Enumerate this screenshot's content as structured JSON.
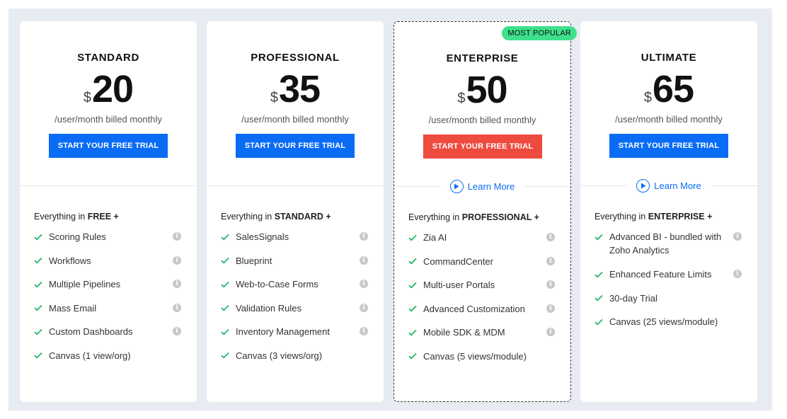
{
  "badge": "MOST POPULAR",
  "plans": [
    {
      "name": "STANDARD",
      "currency": "$",
      "price": "20",
      "billing": "/user/month billed monthly",
      "cta": "START YOUR FREE TRIAL",
      "everything_prefix": "Everything in ",
      "everything_tier": "FREE +",
      "features": [
        "Scoring Rules",
        "Workflows",
        "Multiple Pipelines",
        "Mass Email",
        "Custom Dashboards",
        "Canvas (1 view/org)"
      ]
    },
    {
      "name": "PROFESSIONAL",
      "currency": "$",
      "price": "35",
      "billing": "/user/month billed monthly",
      "cta": "START YOUR FREE TRIAL",
      "everything_prefix": "Everything in ",
      "everything_tier": "STANDARD +",
      "features": [
        "SalesSignals",
        "Blueprint",
        "Web-to-Case Forms",
        "Validation Rules",
        "Inventory Management",
        "Canvas (3 views/org)"
      ]
    },
    {
      "name": "ENTERPRISE",
      "currency": "$",
      "price": "50",
      "billing": "/user/month billed monthly",
      "cta": "START YOUR FREE TRIAL",
      "learn_more": "Learn More",
      "everything_prefix": "Everything in ",
      "everything_tier": "PROFESSIONAL +",
      "features": [
        "Zia AI",
        "CommandCenter",
        "Multi-user Portals",
        "Advanced Customization",
        "Mobile SDK & MDM",
        "Canvas (5 views/module)"
      ]
    },
    {
      "name": "ULTIMATE",
      "currency": "$",
      "price": "65",
      "billing": "/user/month billed monthly",
      "cta": "START YOUR FREE TRIAL",
      "learn_more": "Learn More",
      "everything_prefix": "Everything in ",
      "everything_tier": "ENTERPRISE +",
      "features": [
        "Advanced BI - bundled with Zoho Analytics",
        "Enhanced Feature Limits",
        "30-day Trial",
        "Canvas (25 views/module)"
      ]
    }
  ],
  "colors": {
    "primary_cta": "#0a6cf5",
    "featured_cta": "#ee4b3f",
    "badge": "#3ee08b",
    "check": "#1fb86a",
    "background": "#e7ebf2"
  },
  "icons": {
    "check": "check-icon",
    "info": "info-icon",
    "play": "play-icon"
  }
}
